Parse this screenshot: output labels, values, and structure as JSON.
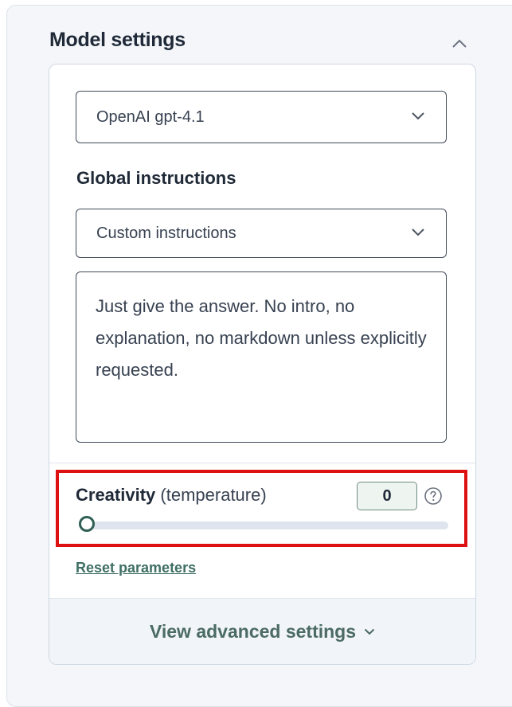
{
  "panel": {
    "title": "Model settings"
  },
  "model_select": {
    "value": "OpenAI gpt-4.1"
  },
  "global_instructions": {
    "label": "Global instructions",
    "select_value": "Custom instructions",
    "text": "Just give the answer. No intro, no explanation, no markdown unless explicitly requested."
  },
  "creativity": {
    "label_bold": "Creativity",
    "label_light": "(temperature)",
    "value": "0",
    "level": 0
  },
  "links": {
    "reset": "Reset parameters"
  },
  "advanced": {
    "label": "View advanced settings"
  },
  "colors": {
    "accent": "#2f5f55",
    "highlight": "#dd1111"
  },
  "icons": {
    "collapse": "chevron-up-icon",
    "select": "chevron-down-icon",
    "help": "question-circle-icon",
    "advanced": "chevron-down-icon"
  }
}
